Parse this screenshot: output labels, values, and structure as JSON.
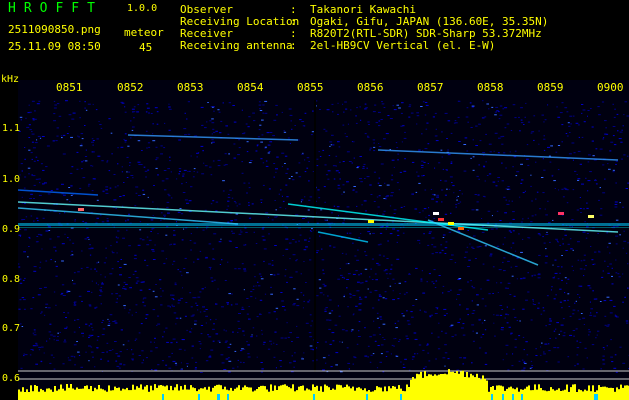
{
  "header": {
    "app_title": "HROFFT",
    "version": "1.0.0",
    "file_name": "2511090850.png",
    "date_time": "25.11.09 08:50",
    "meteor_label": "meteor",
    "meteor_count": "45",
    "info": [
      {
        "key": "Observer",
        "value": "Takanori Kawachi"
      },
      {
        "key": "Receiving Location",
        "value": "Ogaki, Gifu, JAPAN (136.60E, 35.35N)"
      },
      {
        "key": "Receiver",
        "value": "R820T2(RTL-SDR) SDR-Sharp 53.372MHz"
      },
      {
        "key": "Receiving antenna",
        "value": "2el-HB9CV Vertical (el. E-W)"
      }
    ]
  },
  "axes": {
    "freq_unit": "kHz",
    "time_ticks": [
      "0851",
      "0852",
      "0853",
      "0854",
      "0855",
      "0856",
      "0857",
      "0858",
      "0859",
      "0900"
    ],
    "freq_ticks": [
      "1.1",
      "1.0",
      "0.9",
      "0.8",
      "0.7",
      "0.6"
    ]
  },
  "colors": {
    "background": "#000000",
    "text": "#ffff00",
    "title": "#00ff00",
    "noise": "#0000cc",
    "echo": "#00ccff",
    "bar": "#ffff00"
  }
}
